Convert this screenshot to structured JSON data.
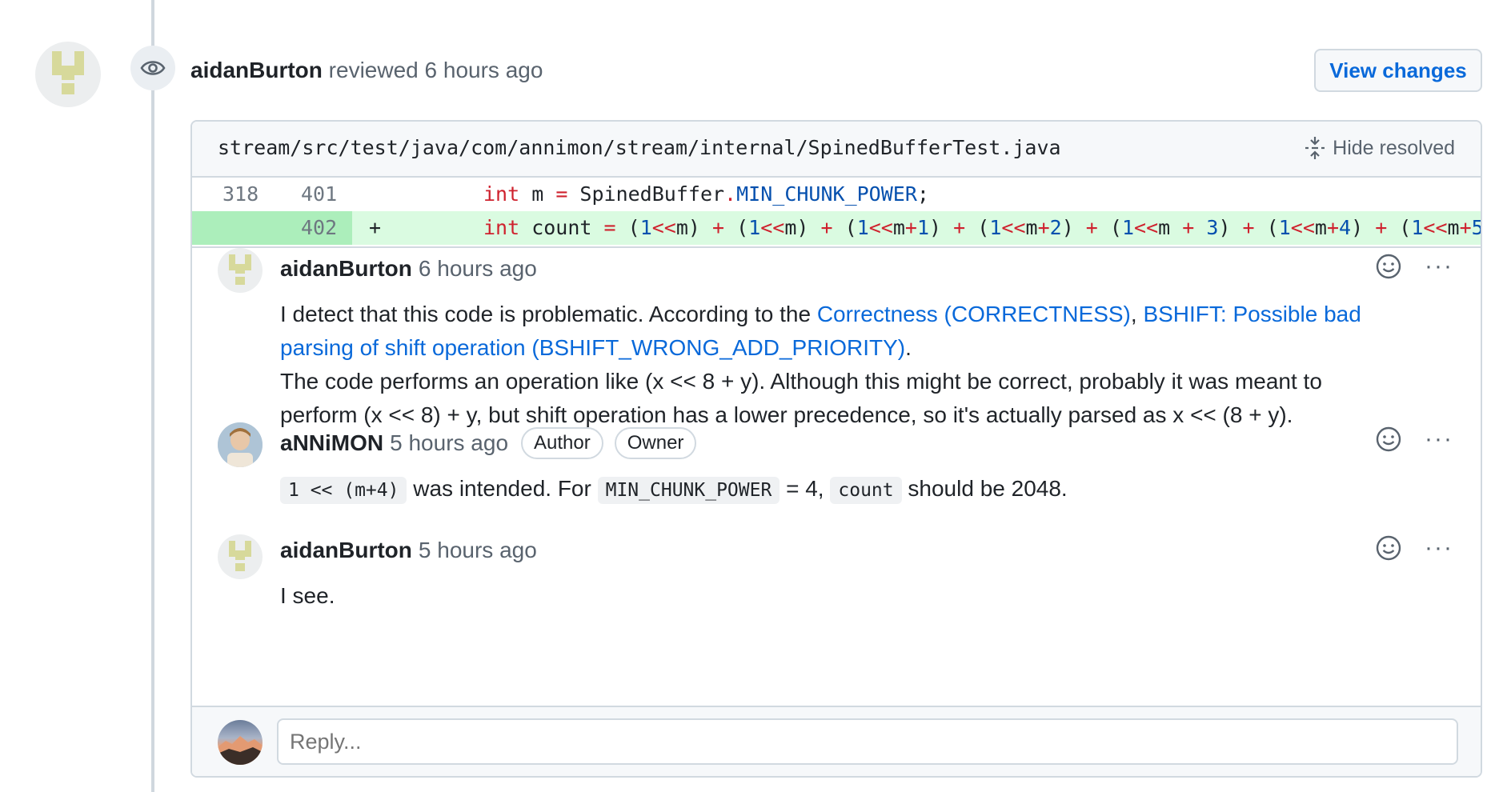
{
  "review": {
    "user": "aidanBurton",
    "action": "reviewed",
    "time": "6 hours ago",
    "view_changes_label": "View changes"
  },
  "file": {
    "path": "stream/src/test/java/com/annimon/stream/internal/SpinedBufferTest.java",
    "hide_resolved_label": "Hide resolved"
  },
  "diff": [
    {
      "old": "318",
      "new": "401",
      "marker": ""
    },
    {
      "old": "",
      "new": "402",
      "marker": "+"
    }
  ],
  "comments": [
    {
      "user": "aidanBurton",
      "time": "6 hours ago",
      "body_intro": "I detect that this code is problematic. According to the ",
      "link1": "Correctness (CORRECTNESS)",
      "sep": ", ",
      "link2": "BSHIFT: Possible bad parsing of shift operation (BSHIFT_WRONG_ADD_PRIORITY)",
      "end": ".",
      "body_line2": "The code performs an operation like (x << 8 + y). Although this might be correct, probably it was meant to perform (x << 8) + y, but shift operation has a lower precedence, so it's actually parsed as x << (8 + y)."
    },
    {
      "user": "aNNiMON",
      "time": "5 hours ago",
      "labels": [
        "Author",
        "Owner"
      ],
      "code1": "1 << (m+4)",
      "text1": " was intended. For ",
      "code2": "MIN_CHUNK_POWER",
      "text2": " = 4, ",
      "code3": "count",
      "text3": " should be 2048."
    },
    {
      "user": "aidanBurton",
      "time": "5 hours ago",
      "body": "I see."
    }
  ],
  "reply": {
    "placeholder": "Reply..."
  },
  "icons": {
    "eye": "eye-icon",
    "fold": "fold-icon",
    "smiley": "smiley-icon",
    "kebab": "kebab-horizontal-icon"
  },
  "colors": {
    "link": "#0969da",
    "added_bg": "#dafbe1",
    "added_gutter": "#aceebb"
  }
}
